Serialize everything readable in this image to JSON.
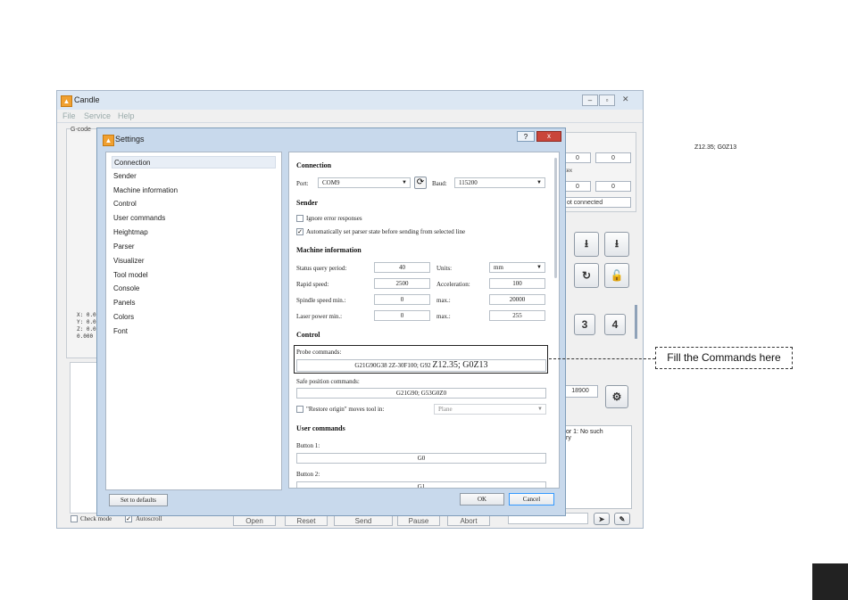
{
  "main_window": {
    "title": "Candle",
    "menu": [
      "File",
      "Service",
      "Help"
    ],
    "gcode_label": "G-code",
    "coords": [
      "X: 0.0",
      "Y: 0.0",
      "Z: 0.0",
      "0.000"
    ],
    "right_panel": {
      "boxes_row1": [
        "0",
        "0"
      ],
      "boxes_row2": [
        "0",
        "0"
      ],
      "status_fragment": "tex",
      "status_text": "ot connected",
      "spindle_value": "18900",
      "console_text": "or 1: No such\nry",
      "jog_buttons": [
        "3",
        "4"
      ]
    },
    "bottom": {
      "check_mode": "Check mode",
      "autoscroll": "Autoscroll",
      "buttons": [
        "Open",
        "Reset",
        "Send",
        "Pause",
        "Abort"
      ]
    }
  },
  "settings": {
    "title": "Settings",
    "help_button": "?",
    "close_button": "x",
    "nav": [
      "Connection",
      "Sender",
      "Machine information",
      "Control",
      "User commands",
      "Heightmap",
      "Parser",
      "Visualizer",
      "Tool model",
      "Console",
      "Panels",
      "Colors",
      "Font"
    ],
    "selected_nav": "Connection",
    "connection": {
      "heading": "Connection",
      "port_label": "Port:",
      "port_value": "COM9",
      "baud_label": "Baud:",
      "baud_value": "115200"
    },
    "sender": {
      "heading": "Sender",
      "ignore_errors": "Ignore error responses",
      "ignore_errors_checked": false,
      "auto_parser": "Automatically set parser state before sending from selected line",
      "auto_parser_checked": true
    },
    "machine_info": {
      "heading": "Machine information",
      "status_query_label": "Status query period:",
      "status_query_value": "40",
      "units_label": "Units:",
      "units_value": "mm",
      "rapid_label": "Rapid speed:",
      "rapid_value": "2500",
      "accel_label": "Acceleration:",
      "accel_value": "100",
      "spindle_min_label": "Spindle speed min.:",
      "spindle_min_value": "0",
      "spindle_max_label": "max.:",
      "spindle_max_value": "20000",
      "laser_min_label": "Laser power min.:",
      "laser_min_value": "0",
      "laser_max_label": "max.:",
      "laser_max_value": "255"
    },
    "control": {
      "heading": "Control",
      "probe_label": "Probe commands:",
      "probe_value": "G21G90G38 2Z-30F100; G92",
      "probe_value_large": "Z12.35; G0Z13",
      "safe_label": "Safe position commands:",
      "safe_value": "G21G90; G53G0Z0",
      "restore_label": "\"Restore origin\" moves tool in:",
      "restore_value": "Plane"
    },
    "user_commands": {
      "heading": "User commands",
      "button1_label": "Button 1:",
      "button1_value": "G0",
      "button2_label": "Button 2:",
      "button2_value": "G1"
    },
    "defaults_button": "Set to defaults",
    "ok_button": "OK",
    "cancel_button": "Cancel"
  },
  "annotations": {
    "top_right_text": "Z12.35; G0Z13",
    "callout_text": "Fill the Commands here"
  },
  "colors": {
    "dialog_frame": "#c8d9ec",
    "accent_highlight": "#3399ff",
    "page_marker": "#222222"
  }
}
